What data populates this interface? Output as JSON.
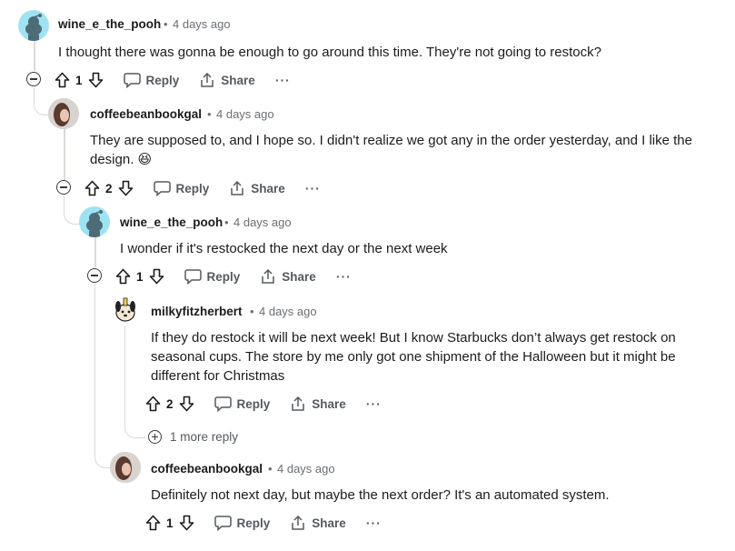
{
  "actions": {
    "reply_label": "Reply",
    "share_label": "Share",
    "more_label": "···"
  },
  "comments": [
    {
      "author": "wine_e_the_pooh",
      "time": "4 days ago",
      "body": "I thought there was gonna be enough to go around this time. They're not going to restock?",
      "votes": "1",
      "avatar": "snoo-avatar"
    },
    {
      "author": "coffeebeanbookgal",
      "time": "4 days ago",
      "body": "They are supposed to, and I hope so. I didn't realize we got any in the order yesterday, and I like the design. 😆",
      "votes": "2",
      "avatar": "photo-avatar"
    },
    {
      "author": "wine_e_the_pooh",
      "time": "4 days ago",
      "body": "I wonder if it's restocked the next day or the next week",
      "votes": "1",
      "avatar": "snoo-avatar"
    },
    {
      "author": "milkyfitzherbert",
      "time": "4 days ago",
      "body": "If they do restock it will be next week! But I know Starbucks don’t always get restock on seasonal cups. The store by me only got one shipment of the Halloween but it might be different for Christmas",
      "votes": "2",
      "avatar": "dog-avatar"
    },
    {
      "author": "coffeebeanbookgal",
      "time": "4 days ago",
      "body": "Definitely not next day, but maybe the next order? It's an automated system.",
      "votes": "1",
      "avatar": "photo-avatar"
    }
  ],
  "more_replies": "1 more reply",
  "separator": "•"
}
